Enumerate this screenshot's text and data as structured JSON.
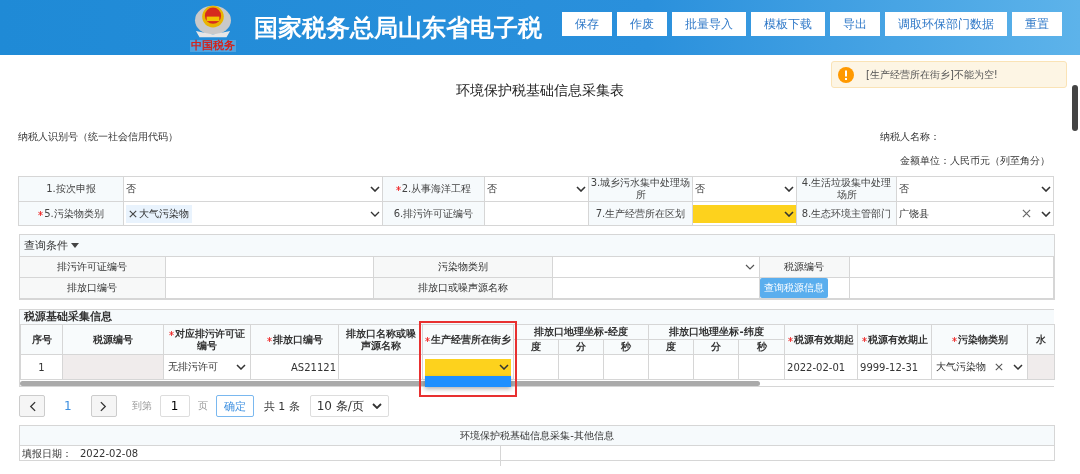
{
  "header": {
    "title": "国家税务总局山东省电子税",
    "logo_caption": "中国税务",
    "buttons": [
      "保存",
      "作废",
      "批量导入",
      "模板下载",
      "导出",
      "调取环保部门数据",
      "重置"
    ]
  },
  "alert": {
    "kind": "warning",
    "text": "[生产经营所在街乡]不能为空!"
  },
  "form": {
    "title": "环境保护税基础信息采集表",
    "taxpayer_id_label": "纳税人识别号（统一社会信用代码）",
    "taxpayer_name_label": "纳税人名称：",
    "unit_note": "金额单位：人民币元（列至角分）"
  },
  "basic_rows": [
    [
      {
        "kind": "label",
        "text": "1.按次申报",
        "required": false
      },
      {
        "kind": "select",
        "value": "否",
        "highlighted": false
      },
      {
        "kind": "label",
        "text": "2.从事海洋工程",
        "required": true
      },
      {
        "kind": "select",
        "value": "否",
        "highlighted": false
      },
      {
        "kind": "label",
        "text": "3.城乡污水集中处理场所",
        "required": false
      },
      {
        "kind": "select",
        "value": "否",
        "highlighted": false
      },
      {
        "kind": "label",
        "text": "4.生活垃圾集中处理场所",
        "required": false
      },
      {
        "kind": "select",
        "value": "否",
        "highlighted": false
      }
    ],
    [
      {
        "kind": "label",
        "text": "5.污染物类别",
        "required": true
      },
      {
        "kind": "tags",
        "tags": [
          "大气污染物"
        ]
      },
      {
        "kind": "label",
        "text": "6.排污许可证编号",
        "required": false
      },
      {
        "kind": "text"
      },
      {
        "kind": "label",
        "text": "7.生产经营所在区划",
        "required": false
      },
      {
        "kind": "select",
        "highlighted": true
      },
      {
        "kind": "label",
        "text": "8.生态环境主管部门",
        "required": false
      },
      {
        "kind": "select",
        "value": "广饶县",
        "highlighted": false,
        "clearable": true
      }
    ]
  ],
  "query": {
    "toggle": "查询条件",
    "expanded": true,
    "rows": [
      [
        {
          "kind": "label",
          "text": "排污许可证编号"
        },
        {
          "kind": "text"
        },
        {
          "kind": "label",
          "text": "污染物类别"
        },
        {
          "kind": "select"
        },
        {
          "kind": "label",
          "text": "税源编号"
        },
        {
          "kind": "text"
        }
      ],
      [
        {
          "kind": "label",
          "text": "排放口编号"
        },
        {
          "kind": "text"
        },
        {
          "kind": "label",
          "text": "排放口或噪声源名称"
        },
        {
          "kind": "text"
        },
        {
          "kind": "button",
          "text": "查询税源信息"
        },
        {
          "kind": "text"
        }
      ]
    ]
  },
  "source_table": {
    "title": "税源基础采集信息",
    "columns": [
      {
        "label": "序号",
        "required": false
      },
      {
        "label": "税源编号",
        "required": false
      },
      {
        "label": "对应排污许可证编号",
        "required": true
      },
      {
        "label": "排放口编号",
        "required": true
      },
      {
        "label": "排放口名称或噪声源名称",
        "required": false
      },
      {
        "label": "生产经营所在街乡",
        "required": true,
        "annotated": true
      },
      {
        "label": "排放口地理坐标-经度",
        "children": [
          "度",
          "分",
          "秒"
        ]
      },
      {
        "label": "排放口地理坐标-纬度",
        "children": [
          "度",
          "分",
          "秒"
        ]
      },
      {
        "label": "税源有效期起",
        "required": true
      },
      {
        "label": "税源有效期止",
        "required": true
      },
      {
        "label": "污染物类别",
        "required": true
      },
      {
        "label": "水",
        "required": false
      }
    ],
    "rows": [
      [
        {
          "kind": "center",
          "value": "1"
        },
        {
          "kind": "readonly"
        },
        {
          "kind": "select",
          "value": "无排污许可"
        },
        {
          "kind": "number",
          "value": "AS21121"
        },
        {
          "kind": "text"
        },
        {
          "kind": "select",
          "highlighted": true,
          "open": true
        },
        {
          "kind": "text"
        },
        {
          "kind": "text"
        },
        {
          "kind": "text"
        },
        {
          "kind": "text"
        },
        {
          "kind": "text"
        },
        {
          "kind": "text"
        },
        {
          "kind": "text",
          "value": "2022-02-01"
        },
        {
          "kind": "text",
          "value": "9999-12-31"
        },
        {
          "kind": "select",
          "value": "大气污染物",
          "clearable": true
        },
        {
          "kind": "readonly"
        }
      ]
    ]
  },
  "pagination": {
    "current": "1",
    "goto_label": "到第",
    "goto_value": "1",
    "page_label": "页",
    "confirm": "确定",
    "total": "共 1 条",
    "page_size": "10 条/页"
  },
  "other_panel": {
    "title": "环境保护税基础信息采集-其他信息",
    "date_label": "填报日期：",
    "date_value": "2022-02-08"
  }
}
